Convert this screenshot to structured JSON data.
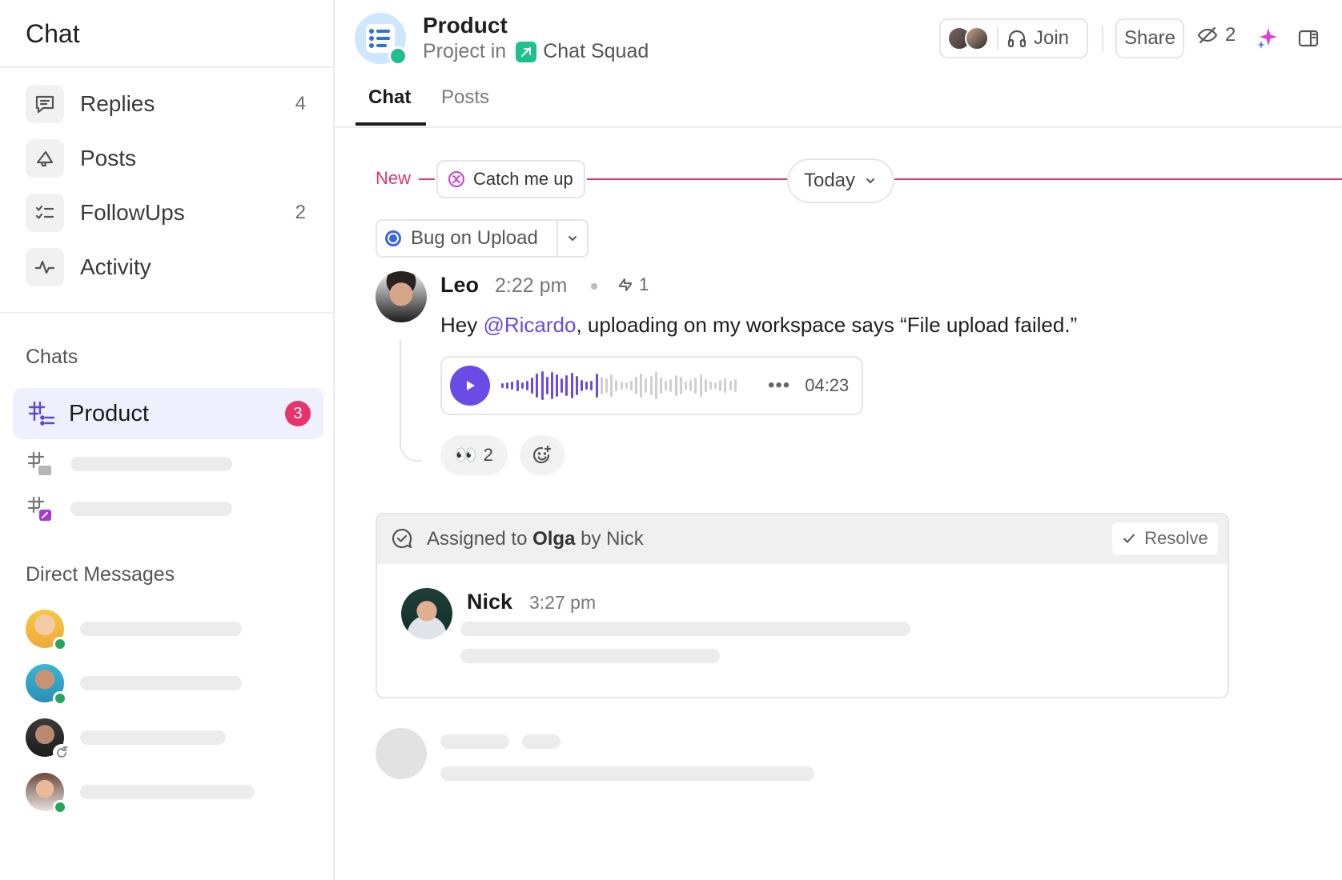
{
  "sidebar": {
    "title": "Chat",
    "nav": [
      {
        "label": "Replies",
        "count": "4",
        "icon": "replies-icon"
      },
      {
        "label": "Posts",
        "count": "",
        "icon": "megaphone-icon"
      },
      {
        "label": "FollowUps",
        "count": "2",
        "icon": "checklist-icon"
      },
      {
        "label": "Activity",
        "count": "",
        "icon": "activity-icon"
      }
    ],
    "chats_label": "Chats",
    "chats": [
      {
        "name": "Product",
        "unread": "3",
        "active": true
      }
    ],
    "dm_label": "Direct Messages"
  },
  "header": {
    "title": "Product",
    "sub_prefix": "Project in",
    "space": "Chat Squad",
    "join_label": "Join",
    "share_label": "Share",
    "watchers": "2"
  },
  "tabs": [
    {
      "label": "Chat",
      "active": true
    },
    {
      "label": "Posts",
      "active": false
    }
  ],
  "divider": {
    "new_label": "New",
    "catch_up_label": "Catch me up",
    "today_label": "Today"
  },
  "task": {
    "name": "Bug on Upload",
    "status_color": "#3b63e6"
  },
  "message": {
    "author": "Leo",
    "time": "2:22 pm",
    "replies": "1",
    "text_before": "Hey ",
    "mention": "@Ricardo",
    "text_after": ", uploading on my workspace says “File upload failed.”",
    "voice": {
      "duration": "04:23",
      "more": "•••",
      "progress": 0.42
    },
    "reaction": {
      "emoji": "👀",
      "count": "2"
    }
  },
  "assignment": {
    "prefix": "Assigned to ",
    "assignee": "Olga",
    "suffix": " by Nick",
    "resolve_label": "Resolve"
  },
  "reply": {
    "author": "Nick",
    "time": "3:27 pm"
  },
  "colors": {
    "accent": "#6a4be6",
    "new_divider": "#e0356f",
    "badge": "#e8336b",
    "online": "#23a55a",
    "active_chat_bg": "#eef0fd"
  }
}
